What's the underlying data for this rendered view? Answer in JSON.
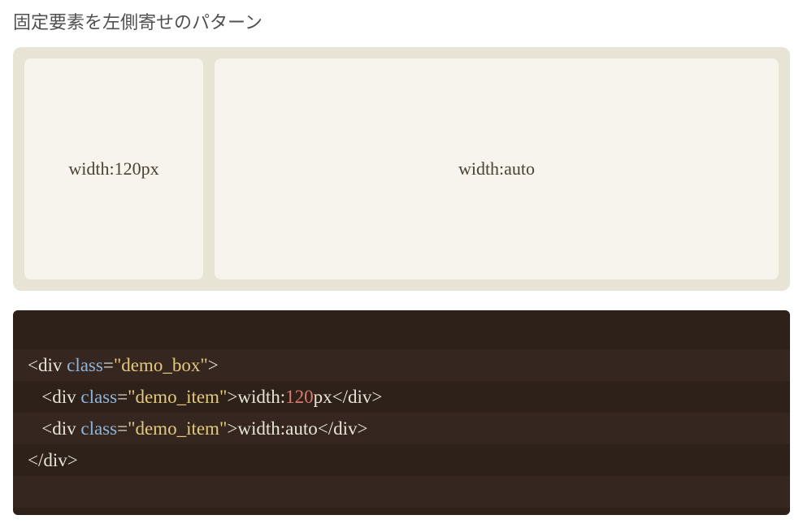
{
  "heading": "固定要素を左側寄せのパターン",
  "demo": {
    "item_fixed_label": "width:120px",
    "item_auto_label": "width:auto"
  },
  "code": {
    "line1": {
      "open_bracket": "<",
      "tag": "div",
      "space": " ",
      "attr": "class",
      "eq": "=",
      "str": "\"demo_box\"",
      "close_bracket": ">"
    },
    "line2": {
      "indent": "   ",
      "open_bracket": "<",
      "tag": "div",
      "space": " ",
      "attr": "class",
      "eq": "=",
      "str": "\"demo_item\"",
      "close_bracket": ">",
      "text_before": "width:",
      "number": "120",
      "text_after": "px",
      "close_open": "</",
      "close_tag": "div",
      "close_close": ">"
    },
    "line3": {
      "indent": "   ",
      "open_bracket": "<",
      "tag": "div",
      "space": " ",
      "attr": "class",
      "eq": "=",
      "str": "\"demo_item\"",
      "close_bracket": ">",
      "text": "width:auto",
      "close_open": "</",
      "close_tag": "div",
      "close_close": ">"
    },
    "line4": {
      "close_open": "</",
      "close_tag": "div",
      "close_close": ">"
    }
  }
}
